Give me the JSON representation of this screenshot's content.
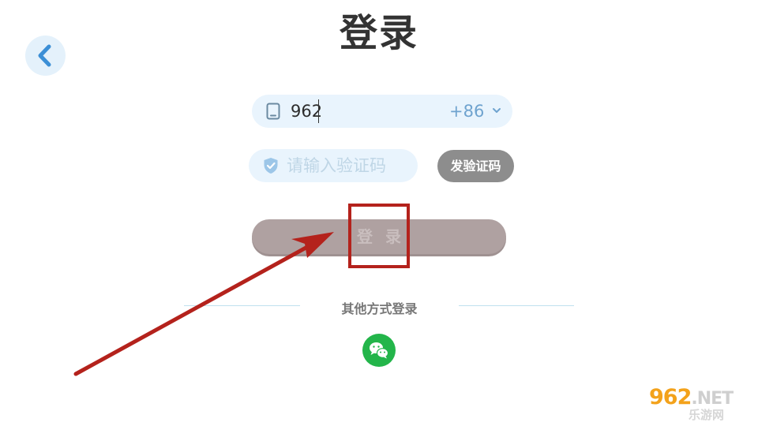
{
  "header": {
    "title": "登录",
    "back_icon": "chevron-left-icon"
  },
  "phone": {
    "value": "962",
    "country_code": "+86",
    "icon": "phone-icon",
    "chevron_icon": "chevron-down-icon"
  },
  "code": {
    "placeholder": "请输入验证码",
    "value": "",
    "icon": "shield-check-icon",
    "send_label": "发验证码"
  },
  "login": {
    "label": "登录"
  },
  "other_login": {
    "label": "其他方式登录",
    "methods": [
      "wechat-icon"
    ]
  },
  "watermark": {
    "site": "962",
    "tld": ".NET",
    "name": "乐游网"
  },
  "colors": {
    "annotation": "#b4221c",
    "field_bg": "#e9f4fd",
    "wechat": "#23b54a",
    "send_button": "#8d8d8d",
    "login_button": "#afa1a1"
  }
}
